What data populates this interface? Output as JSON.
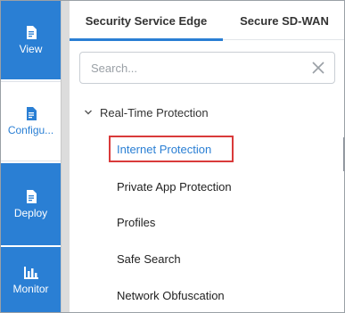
{
  "nav": {
    "items": [
      {
        "label": "View",
        "icon": "document-icon",
        "active": false
      },
      {
        "label": "Configu...",
        "icon": "document-icon",
        "active": true
      },
      {
        "label": "Deploy",
        "icon": "document-icon",
        "active": false
      },
      {
        "label": "Monitor",
        "icon": "bar-chart-icon",
        "active": false
      }
    ]
  },
  "tabs": [
    {
      "label": "Security Service Edge",
      "active": true
    },
    {
      "label": "Secure SD-WAN",
      "active": false
    }
  ],
  "search": {
    "placeholder": "Search..."
  },
  "tree": {
    "section": "Real-Time Protection",
    "items": [
      {
        "label": "Internet Protection",
        "highlighted": true
      },
      {
        "label": "Private App Protection",
        "highlighted": false
      },
      {
        "label": "Profiles",
        "highlighted": false
      },
      {
        "label": "Safe Search",
        "highlighted": false
      },
      {
        "label": "Network Obfuscation",
        "highlighted": false
      }
    ]
  },
  "colors": {
    "accent": "#2a7fd4",
    "highlight_border": "#d93a3a"
  }
}
